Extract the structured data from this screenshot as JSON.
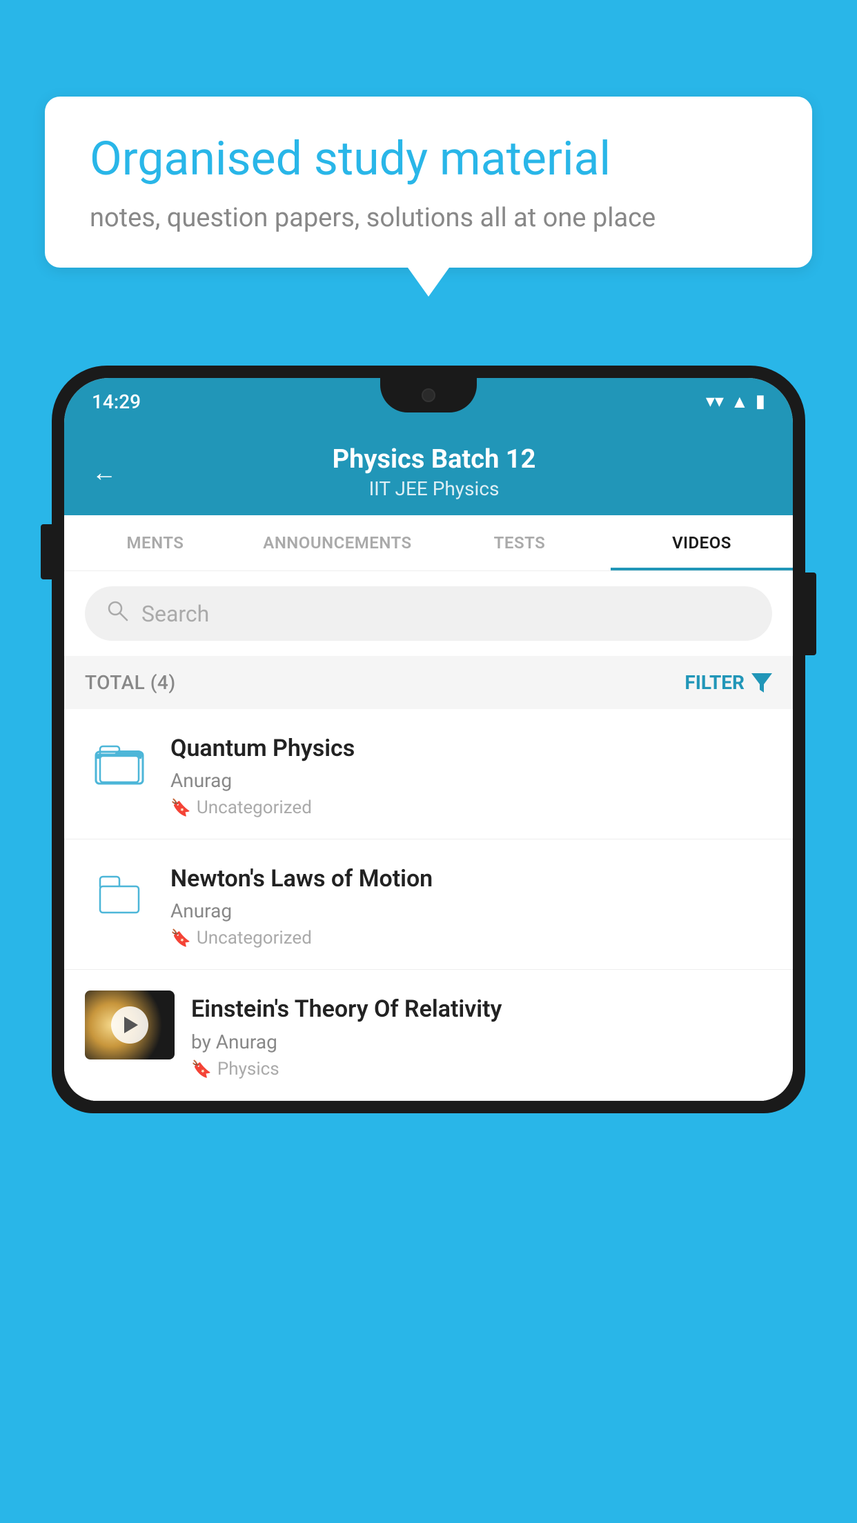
{
  "background_color": "#29b6e8",
  "bubble": {
    "title": "Organised study material",
    "subtitle": "notes, question papers, solutions all at one place"
  },
  "status_bar": {
    "time": "14:29",
    "wifi": "▼",
    "signal": "▲",
    "battery": "▮"
  },
  "header": {
    "back_label": "←",
    "title": "Physics Batch 12",
    "subtitle": "IIT JEE   Physics"
  },
  "tabs": [
    {
      "label": "MENTS",
      "active": false
    },
    {
      "label": "ANNOUNCEMENTS",
      "active": false
    },
    {
      "label": "TESTS",
      "active": false
    },
    {
      "label": "VIDEOS",
      "active": true
    }
  ],
  "search": {
    "placeholder": "Search"
  },
  "filter_bar": {
    "total_label": "TOTAL (4)",
    "filter_label": "FILTER"
  },
  "videos": [
    {
      "title": "Quantum Physics",
      "author": "Anurag",
      "tag": "Uncategorized",
      "has_thumbnail": false
    },
    {
      "title": "Newton's Laws of Motion",
      "author": "Anurag",
      "tag": "Uncategorized",
      "has_thumbnail": false
    },
    {
      "title": "Einstein's Theory Of Relativity",
      "author": "by Anurag",
      "tag": "Physics",
      "has_thumbnail": true
    }
  ]
}
